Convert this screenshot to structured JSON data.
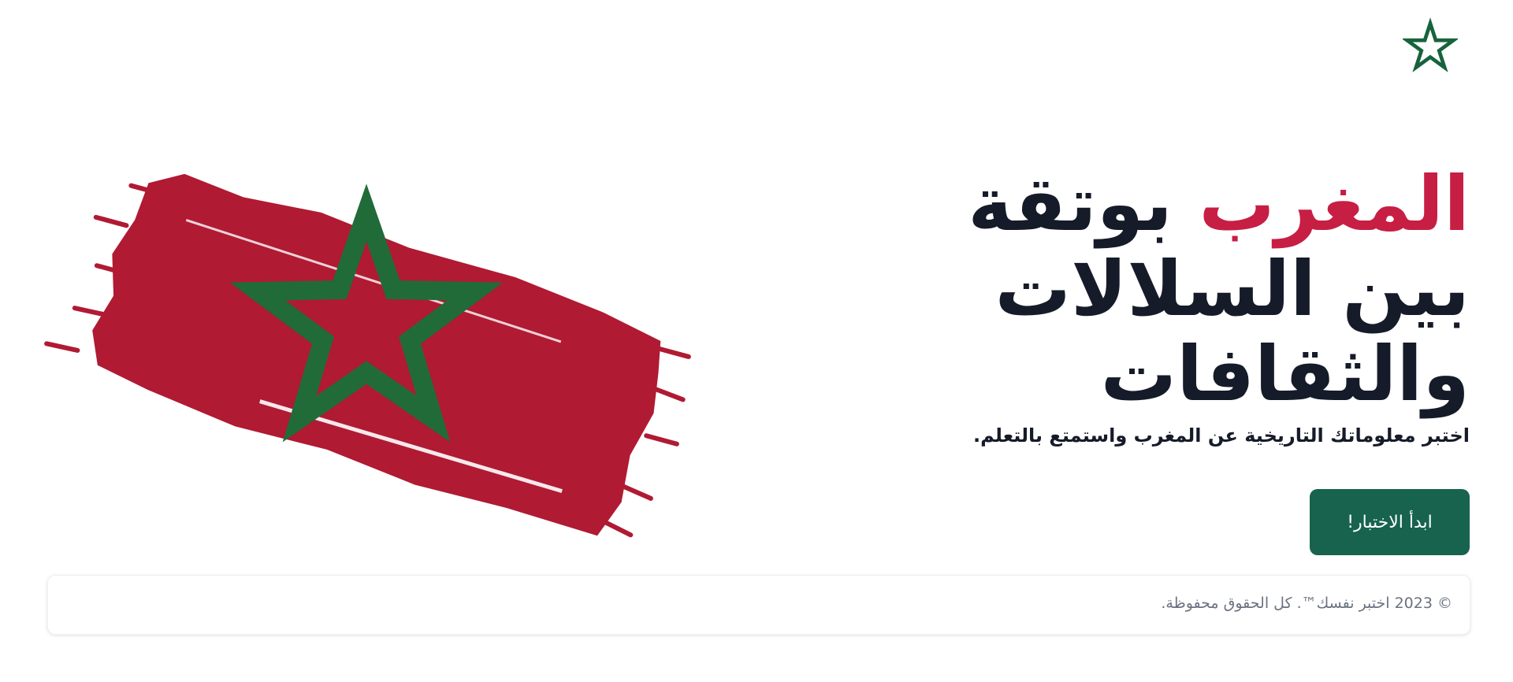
{
  "brand": {
    "logo_icon": "moroccan-star-icon",
    "accent_color": "#c71e44",
    "primary_color": "#17634e",
    "text_color": "#161b29"
  },
  "hero": {
    "title_accent": "المغرب",
    "title_rest_1": " بوتقة",
    "title_line_2": "بين السلالات",
    "title_line_3": "والثقافات",
    "subtitle": "اختبر معلوماتك التاريخية عن المغرب واستمتع بالتعلم.",
    "flag_image": "morocco-flag-brush-image",
    "cta_label": "ابدأ الاختبار!"
  },
  "footer": {
    "copyright": "© 2023 اختبر نفسك™. كل الحقوق محفوظة."
  }
}
